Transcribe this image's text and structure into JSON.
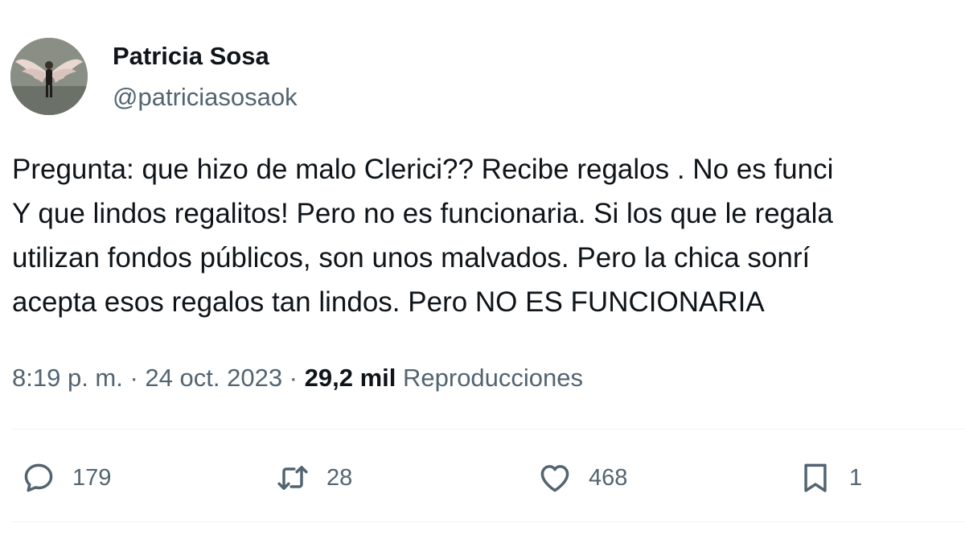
{
  "author": {
    "display_name": "Patricia Sosa",
    "handle": "@patriciasosaok",
    "avatar_icon": "profile-photo-winged-figure"
  },
  "tweet": {
    "lines": [
      "Pregunta: que hizo de malo Clerici?? Recibe regalos . No es funci",
      "Y que lindos regalitos! Pero no es funcionaria. Si los que le regala",
      "utilizan fondos públicos, son unos malvados. Pero la chica sonrí",
      "acepta esos regalos tan lindos. Pero NO ES FUNCIONARIA"
    ]
  },
  "meta": {
    "time": "8:19 p. m.",
    "separator": " · ",
    "date": "24 oct. 2023",
    "views_count": "29,2 mil",
    "views_label": "Reproducciones"
  },
  "actions": {
    "reply": {
      "icon": "reply-icon",
      "count": "179"
    },
    "retweet": {
      "icon": "retweet-icon",
      "count": "28"
    },
    "like": {
      "icon": "heart-icon",
      "count": "468"
    },
    "bookmark": {
      "icon": "bookmark-icon",
      "count": "1"
    }
  },
  "colors": {
    "primary_text": "#0f1419",
    "secondary_text": "#536471",
    "divider": "#eff3f4"
  }
}
